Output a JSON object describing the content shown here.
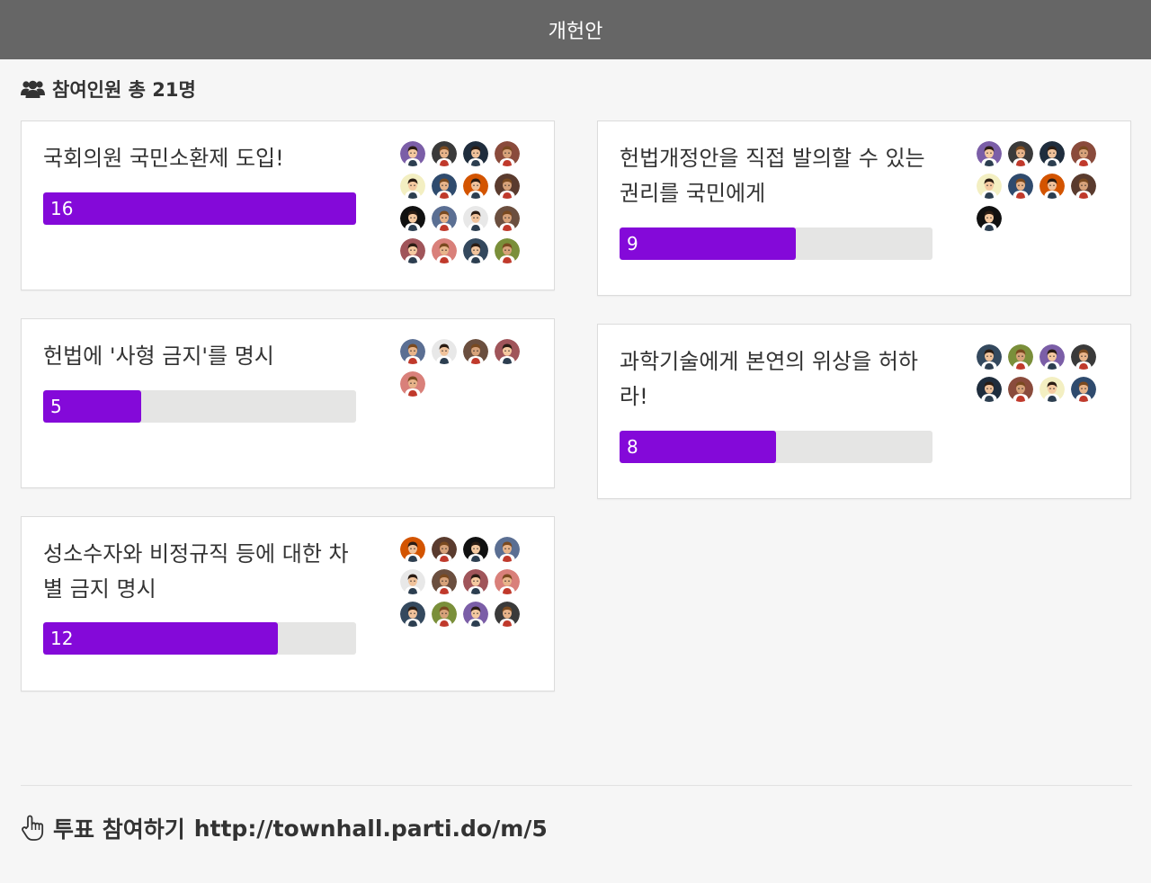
{
  "header": {
    "title": "개헌안"
  },
  "participants": {
    "icon": "users-icon",
    "label": "참여인원 총 21명"
  },
  "colors": {
    "bar_fill": "#8409d9",
    "bar_track": "#e5e5e4",
    "header_bg": "#666666"
  },
  "cards": [
    {
      "title": "국회의원 국민소환제 도입!",
      "votes": "16",
      "fraction": 1.0,
      "avatars": 16
    },
    {
      "title": "헌법개정안을 직접 발의할 수 있는 권리를 국민에게",
      "votes": "9",
      "fraction": 0.5625,
      "avatars": 9
    },
    {
      "title": "헌법에 '사형 금지'를 명시",
      "votes": "5",
      "fraction": 0.3125,
      "avatars": 5
    },
    {
      "title": "과학기술에게 본연의 위상을 허하라!",
      "votes": "8",
      "fraction": 0.5,
      "avatars": 8
    },
    {
      "title": "성소수자와 비정규직 등에 대한 차별 금지 명시",
      "votes": "12",
      "fraction": 0.75,
      "avatars": 12
    }
  ],
  "footer": {
    "icon": "hand-pointer-icon",
    "label": "투표 참여하기",
    "url": "http://townhall.parti.do/m/5"
  }
}
